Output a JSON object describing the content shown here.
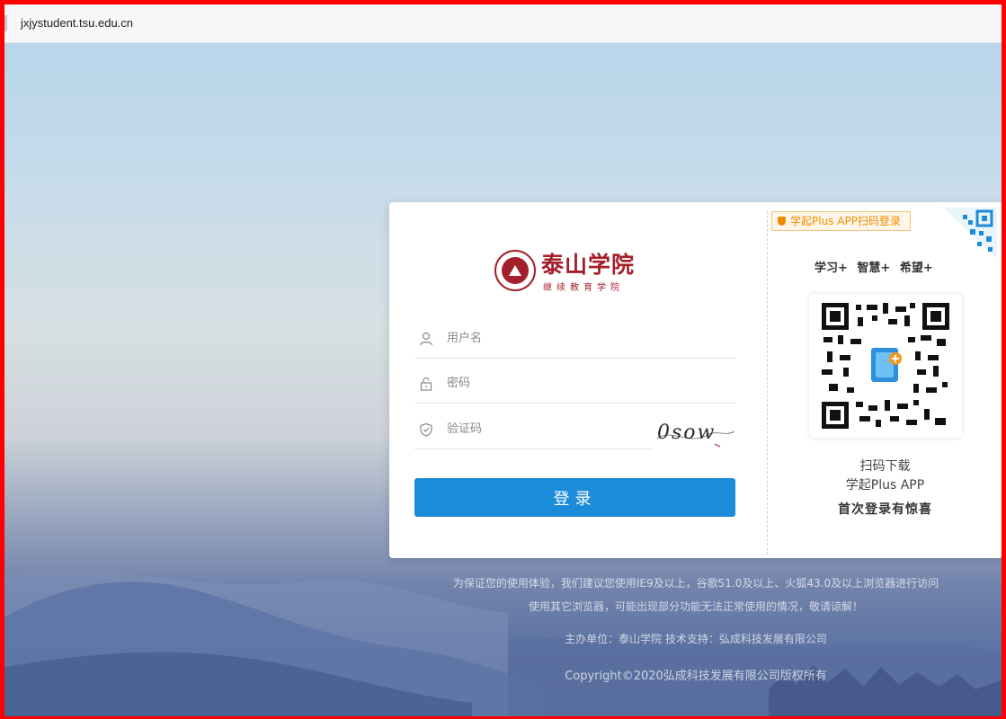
{
  "browser": {
    "url": "jxjystudent.tsu.edu.cn"
  },
  "logo": {
    "name": "泰山学院",
    "subtitle": "继续教育学院"
  },
  "form": {
    "username_placeholder": "用户名",
    "password_placeholder": "密码",
    "captcha_placeholder": "验证码",
    "captcha_text": "0sow",
    "login_label": "登录"
  },
  "app_panel": {
    "scan_tag": "学起Plus APP扫码登录",
    "slogan": "学习+ 智慧+ 希望+",
    "download_line1": "扫码下载",
    "download_line2": "学起Plus APP",
    "download_line3": "首次登录有惊喜"
  },
  "footer": {
    "line1": "为保证您的使用体验，我们建议您使用IE9及以上，谷歌51.0及以上、火狐43.0及以上浏览器进行访问",
    "line2": "使用其它浏览器，可能出现部分功能无法正常使用的情况，敬请谅解！",
    "line3": "主办单位：泰山学院 技术支持：弘成科技发展有限公司",
    "line4": "Copyright©2020弘成科技发展有限公司版权所有"
  },
  "colors": {
    "brand_red": "#a3202a",
    "button_blue": "#1c8bd9",
    "tag_orange": "#f08b00",
    "frame_red": "#ff0000"
  },
  "icons": [
    "user-icon",
    "lock-icon",
    "shield-check-icon",
    "qr-code-icon"
  ]
}
